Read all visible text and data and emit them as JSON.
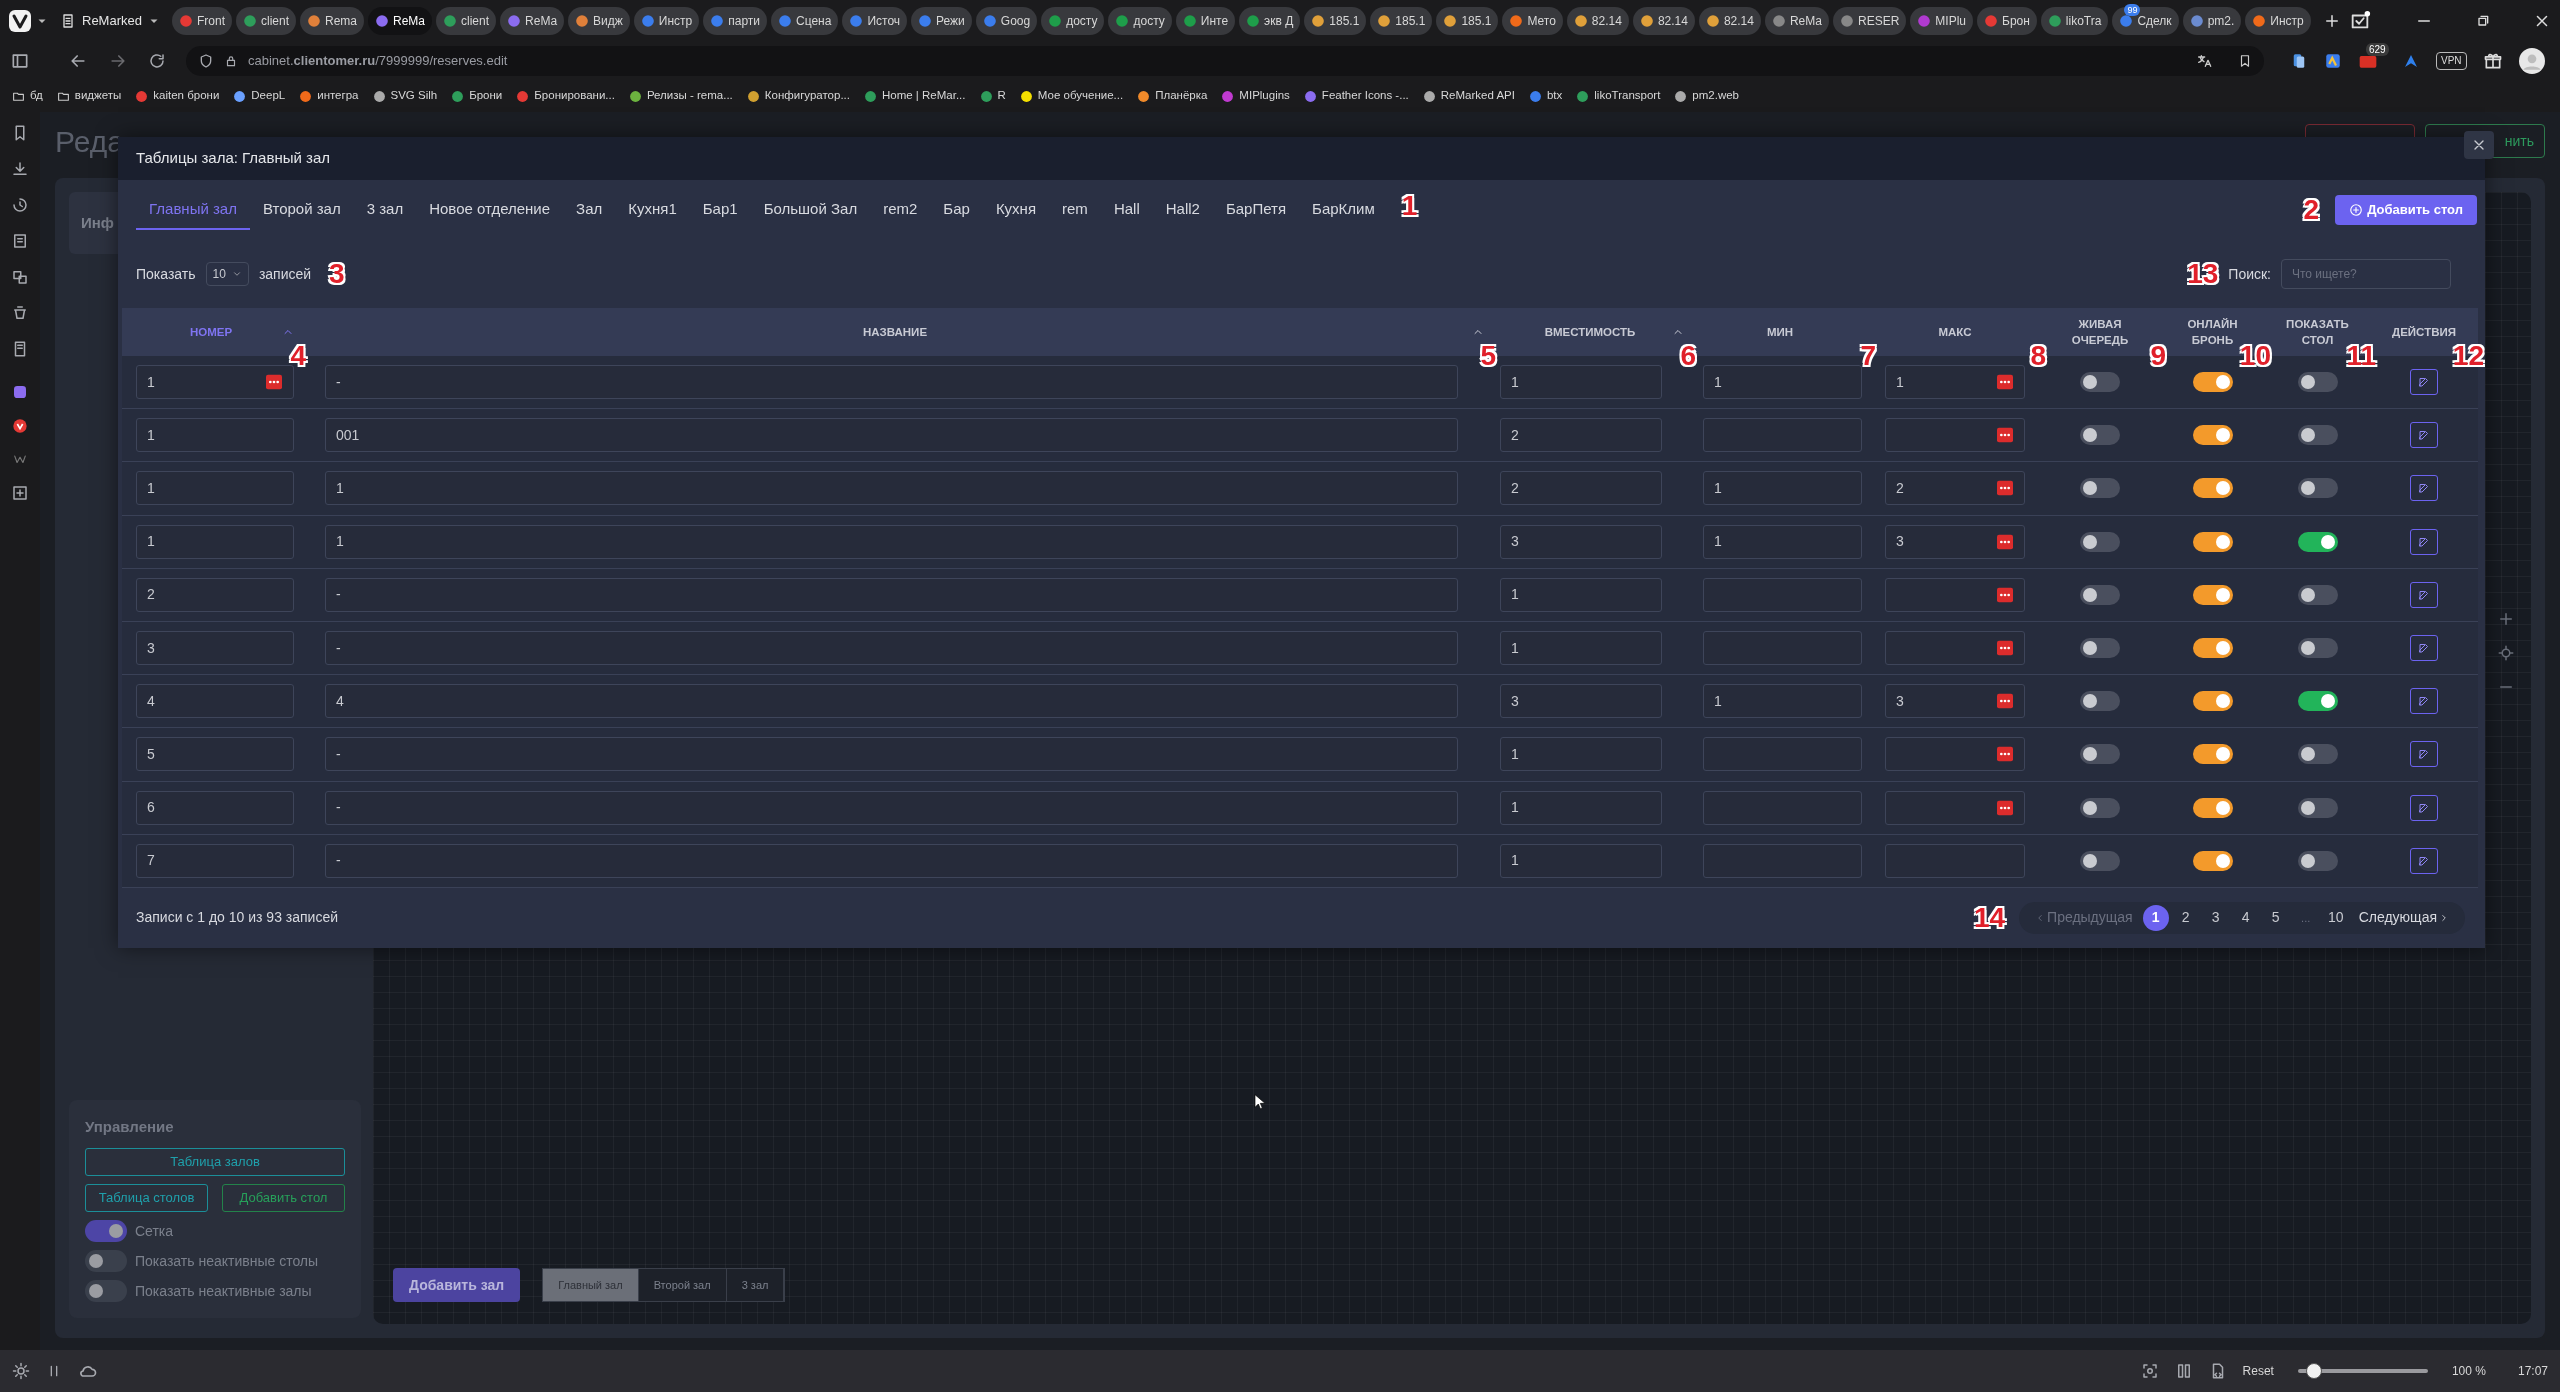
{
  "browser": {
    "tab_group": "ReMarked",
    "tabs": [
      {
        "label": "Front",
        "selected": false
      },
      {
        "label": "client",
        "selected": false
      },
      {
        "label": "Rema",
        "selected": false
      },
      {
        "label": "ReMa",
        "selected": true
      },
      {
        "label": "client",
        "selected": false
      },
      {
        "label": "ReMa",
        "selected": false
      },
      {
        "label": "Видж",
        "selected": false
      },
      {
        "label": "Инстр",
        "selected": false
      },
      {
        "label": "парти",
        "selected": false
      },
      {
        "label": "Сцена",
        "selected": false
      },
      {
        "label": "Источ",
        "selected": false
      },
      {
        "label": "Режи",
        "selected": false
      },
      {
        "label": "Goog",
        "selected": false
      },
      {
        "label": "досту",
        "selected": false
      },
      {
        "label": "досту",
        "selected": false
      },
      {
        "label": "Инте",
        "selected": false
      },
      {
        "label": "экв Д",
        "selected": false
      },
      {
        "label": "185.1",
        "selected": false
      },
      {
        "label": "185.1",
        "selected": false
      },
      {
        "label": "185.1",
        "selected": false
      },
      {
        "label": "Мето",
        "selected": false
      },
      {
        "label": "82.14",
        "selected": false
      },
      {
        "label": "82.14",
        "selected": false
      },
      {
        "label": "82.14",
        "selected": false
      },
      {
        "label": "ReMa",
        "selected": false
      },
      {
        "label": "RESER",
        "selected": false
      },
      {
        "label": "MIPlu",
        "selected": false
      },
      {
        "label": "Брон",
        "selected": false
      },
      {
        "label": "likoTra",
        "selected": false
      },
      {
        "label": "Сделк",
        "selected": false,
        "badge": "99"
      },
      {
        "label": "pm2.",
        "selected": false
      },
      {
        "label": "Инстр",
        "selected": false
      }
    ],
    "url": "cabinet.**clientomer.ru**/7999999/reserves.edit",
    "extension_badge": "629",
    "vpn_label": "VPN",
    "bookmarks": [
      "бд",
      "виджеты",
      "kaiten брони",
      "DeepL",
      "интегра",
      "SVG Silh",
      "Брони",
      "Бронировани...",
      "Релизы - rema...",
      "Конфигуратор...",
      "Home | ReMar...",
      "R",
      "Мое обучение...",
      "Планёрка",
      "MIPlugins",
      "Feather Icons -...",
      "ReMarked API",
      "btx",
      "likoTransport",
      "pm2.web"
    ]
  },
  "page": {
    "title": "Реда",
    "info_tab": "Инф",
    "save_button": "нить",
    "management": {
      "title": "Управление",
      "buttons": [
        {
          "label": "Таблица залов",
          "kind": "wide"
        },
        {
          "label": "Таблица столов",
          "kind": "teal"
        },
        {
          "label": "Добавить стол",
          "kind": "green"
        }
      ],
      "switches": [
        {
          "label": "Сетка",
          "on": true
        },
        {
          "label": "Показать неактивные столы",
          "on": false
        },
        {
          "label": "Показать неактивные залы",
          "on": false
        }
      ]
    },
    "add_hall_button": "Добавить зал",
    "hall_tabs": [
      {
        "label": "Главный зал",
        "selected": true
      },
      {
        "label": "Второй зал",
        "selected": false
      },
      {
        "label": "3 зал",
        "selected": false
      }
    ]
  },
  "modal": {
    "title": "Таблицы зала: Главный зал",
    "tabs": [
      {
        "label": "Главный зал",
        "selected": true
      },
      {
        "label": "Второй зал",
        "selected": false
      },
      {
        "label": "3 зал",
        "selected": false
      },
      {
        "label": "Новое отделение",
        "selected": false
      },
      {
        "label": "Зал",
        "selected": false
      },
      {
        "label": "Кухня1",
        "selected": false
      },
      {
        "label": "Бар1",
        "selected": false
      },
      {
        "label": "Большой Зал",
        "selected": false
      },
      {
        "label": "rem2",
        "selected": false
      },
      {
        "label": "Бар",
        "selected": false
      },
      {
        "label": "Кухня",
        "selected": false
      },
      {
        "label": "rem",
        "selected": false
      },
      {
        "label": "Hall",
        "selected": false
      },
      {
        "label": "Hall2",
        "selected": false
      },
      {
        "label": "БарПетя",
        "selected": false
      },
      {
        "label": "БарКлим",
        "selected": false
      }
    ],
    "tabs_marker": "1",
    "add_button": {
      "label": "Добавить стол",
      "marker": "2"
    },
    "length": {
      "prefix": "Показать",
      "value": "10",
      "suffix": "записей",
      "marker": "3"
    },
    "search": {
      "label": "Поиск:",
      "placeholder": "Что ищете?",
      "marker": "13"
    },
    "columns": [
      {
        "label": "НОМЕР",
        "sortable": true,
        "sorted": true,
        "marker": "4"
      },
      {
        "label": "НАЗВАНИЕ",
        "sortable": true,
        "sorted": false,
        "marker": "5"
      },
      {
        "label": "ВМЕСТИМОСТЬ",
        "sortable": true,
        "sorted": false,
        "marker": "6"
      },
      {
        "label": "МИН",
        "sortable": false,
        "sorted": false,
        "marker": "7"
      },
      {
        "label": "МАКС",
        "sortable": false,
        "sorted": false,
        "marker": "8"
      },
      {
        "label": "ЖИВАЯ ОЧЕРЕДЬ",
        "sortable": false,
        "sorted": false,
        "marker": "9"
      },
      {
        "label": "ОНЛАЙН БРОНЬ",
        "sortable": false,
        "sorted": false,
        "marker": "10"
      },
      {
        "label": "ПОКАЗАТЬ СТОЛ",
        "sortable": false,
        "sorted": false,
        "marker": "11"
      },
      {
        "label": "ДЕЙСТВИЯ",
        "sortable": false,
        "sorted": false,
        "marker": "12"
      }
    ],
    "rows": [
      {
        "number": "1",
        "number_alert": true,
        "name": "-",
        "capacity": "1",
        "min": "1",
        "max": "1",
        "max_alert": true,
        "live_queue": false,
        "online_booking": true,
        "show_table": false
      },
      {
        "number": "1",
        "number_alert": false,
        "name": "001",
        "capacity": "2",
        "max_alert": true,
        "live_queue": false,
        "online_booking": true,
        "show_table": false
      },
      {
        "number": "1",
        "number_alert": false,
        "name": "1",
        "capacity": "2",
        "min": "1",
        "max": "2",
        "max_alert": true,
        "live_queue": false,
        "online_booking": true,
        "show_table": false
      },
      {
        "number": "1",
        "number_alert": false,
        "name": "1",
        "capacity": "3",
        "min": "1",
        "max": "3",
        "max_alert": true,
        "live_queue": false,
        "online_booking": true,
        "show_table": true
      },
      {
        "number": "2",
        "number_alert": false,
        "name": "-",
        "capacity": "1",
        "max_alert": true,
        "live_queue": false,
        "online_booking": true,
        "show_table": false
      },
      {
        "number": "3",
        "number_alert": false,
        "name": "-",
        "capacity": "1",
        "max_alert": true,
        "live_queue": false,
        "online_booking": true,
        "show_table": false
      },
      {
        "number": "4",
        "number_alert": false,
        "name": "4",
        "capacity": "3",
        "min": "1",
        "max": "3",
        "max_alert": true,
        "live_queue": false,
        "online_booking": true,
        "show_table": true
      },
      {
        "number": "5",
        "number_alert": false,
        "name": "-",
        "capacity": "1",
        "max_alert": true,
        "live_queue": false,
        "online_booking": true,
        "show_table": false
      },
      {
        "number": "6",
        "number_alert": false,
        "name": "-",
        "capacity": "1",
        "max_alert": true,
        "live_queue": false,
        "online_booking": true,
        "show_table": false
      },
      {
        "number": "7",
        "number_alert": false,
        "name": "-",
        "capacity": "1",
        "max_alert": false,
        "live_queue": false,
        "online_booking": true,
        "show_table": false
      }
    ],
    "info": "Записи с 1 до 10 из 93 записей",
    "pagination": {
      "marker": "14",
      "prev": {
        "label": "Предыдущая",
        "disabled": true
      },
      "pages": [
        {
          "label": "1",
          "selected": true
        },
        {
          "label": "2",
          "selected": false
        },
        {
          "label": "3",
          "selected": false
        },
        {
          "label": "4",
          "selected": false
        },
        {
          "label": "5",
          "selected": false
        },
        {
          "label": "...",
          "selected": false,
          "kind": "ellipsis"
        },
        {
          "label": "10",
          "selected": false
        }
      ],
      "next": {
        "label": "Следующая",
        "disabled": false
      }
    }
  },
  "status_bar": {
    "reset": "Reset",
    "zoom": {
      "level": 0.12
    },
    "zoom_label": "100 %",
    "clock": "17:07"
  }
}
